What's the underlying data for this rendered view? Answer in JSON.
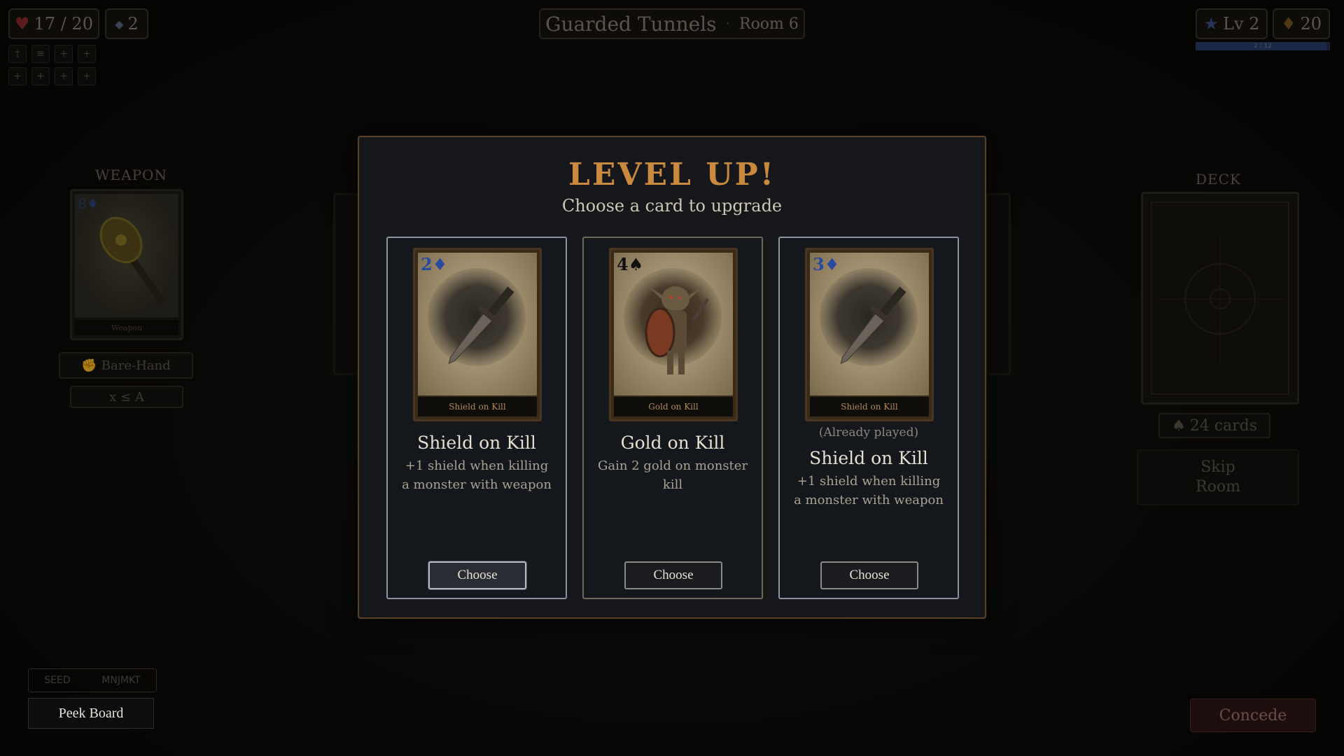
{
  "hud": {
    "health": "17 / 20",
    "shield": "2",
    "location": "Guarded Tunnels",
    "room": "Room 6",
    "level": "Lv 2",
    "gold": "20",
    "xp_text": "2 / 12",
    "xp_progress": 0.98
  },
  "tool_icons": [
    "†",
    "≡",
    "+",
    "+",
    "+",
    "+",
    "+",
    "+"
  ],
  "weapon_panel": {
    "title": "WEAPON",
    "rank": "8",
    "card_caption": "Weapon",
    "mode_button": "Bare-Hand",
    "rule_text": "x ≤ A"
  },
  "deck_panel": {
    "title": "DECK",
    "card_count": "24 cards",
    "skip_button": "Skip Room"
  },
  "modal": {
    "title": "LEVEL UP!",
    "subtitle": "Choose a card to upgrade",
    "choices": [
      {
        "rank": "2",
        "suit": "♦",
        "suit_color": "#2a4aa0",
        "caption": "Shield on Kill",
        "note": "",
        "name": "Shield on Kill",
        "description": "+1 shield when killing a monster with weapon",
        "button": "Choose"
      },
      {
        "rank": "4",
        "suit": "♠",
        "suit_color": "#111111",
        "caption": "Gold on Kill",
        "note": "",
        "name": "Gold on Kill",
        "description": "Gain 2 gold on monster kill",
        "button": "Choose"
      },
      {
        "rank": "3",
        "suit": "♦",
        "suit_color": "#2a4aa0",
        "caption": "Shield on Kill",
        "note": "(Already played)",
        "name": "Shield on Kill",
        "description": "+1 shield when killing a monster with weapon",
        "button": "Choose"
      }
    ]
  },
  "bottom": {
    "seed_label": "SEED",
    "seed_value": "MNJMKT",
    "peek_button": "Peek Board",
    "concede_button": "Concede"
  },
  "colors": {
    "accent_gold": "#c9893e",
    "modal_border": "#5a4424",
    "heart": "#8c2a2a"
  }
}
